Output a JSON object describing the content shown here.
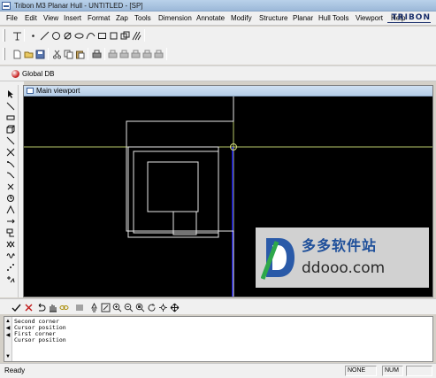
{
  "window": {
    "title": "Tribon M3 Planar Hull - UNTITLED - [SP]"
  },
  "menu": [
    "File",
    "Edit",
    "View",
    "Insert",
    "Format",
    "Zap",
    "Tools",
    "Dimension",
    "Annotate",
    "Modify",
    "Structure",
    "Planar",
    "Hull Tools",
    "Viewport",
    "Help"
  ],
  "brand": {
    "name": "TRIBON"
  },
  "db_tab": {
    "label": "Global DB"
  },
  "viewport": {
    "title": "Main viewport"
  },
  "draw_toolbar": [
    "text-tool-icon",
    "point-icon",
    "line-icon",
    "circle-icon",
    "arc-icon",
    "ellipse-icon",
    "spline-icon",
    "rectangle-icon",
    "box-icon",
    "copy-shape-icon",
    "hatch-icon"
  ],
  "file_toolbar": [
    "new-file-icon",
    "open-icon",
    "save-icon",
    "cut-icon",
    "copy-icon",
    "paste-icon",
    "print-icon",
    "print-preview-icon",
    "tool-a-icon",
    "tool-b-icon",
    "tool-c-icon",
    "tool-d-icon"
  ],
  "side_toolbar": [
    "select-arrow-icon",
    "line-tool-icon",
    "measure-icon",
    "box-tool-icon",
    "diagonal-icon",
    "cross-icon",
    "bend-icon",
    "curve-icon",
    "x-cross-icon",
    "circle-tool-icon",
    "angle-icon",
    "move-icon",
    "connect-icon",
    "mirror-icon",
    "wave-icon",
    "dots-icon",
    "plus-angle-icon"
  ],
  "bottom_toolbar": [
    "check-icon",
    "cancel-x-icon",
    "undo-icon",
    "pan-hand-icon",
    "link-icon",
    "ruler-icon",
    "lamp-icon",
    "zoom-window-icon",
    "zoom-in-icon",
    "zoom-out-icon",
    "zoom-all-icon",
    "rotate-icon",
    "gear-icon",
    "pan-arrows-icon"
  ],
  "log": {
    "lines": [
      "Second corner",
      "Cursor position",
      "First corner",
      "Cursor position"
    ]
  },
  "status": {
    "text": "Ready",
    "pane1": "NONE",
    "pane2": "NUM",
    "pane3": ""
  },
  "watermark": {
    "cn": "多多软件站",
    "url": "ddooo.com"
  },
  "colors": {
    "canvas": "#000000",
    "geometry": "#ffffff",
    "axis": "#c8d46a",
    "accent_line": "#1a1aff"
  }
}
